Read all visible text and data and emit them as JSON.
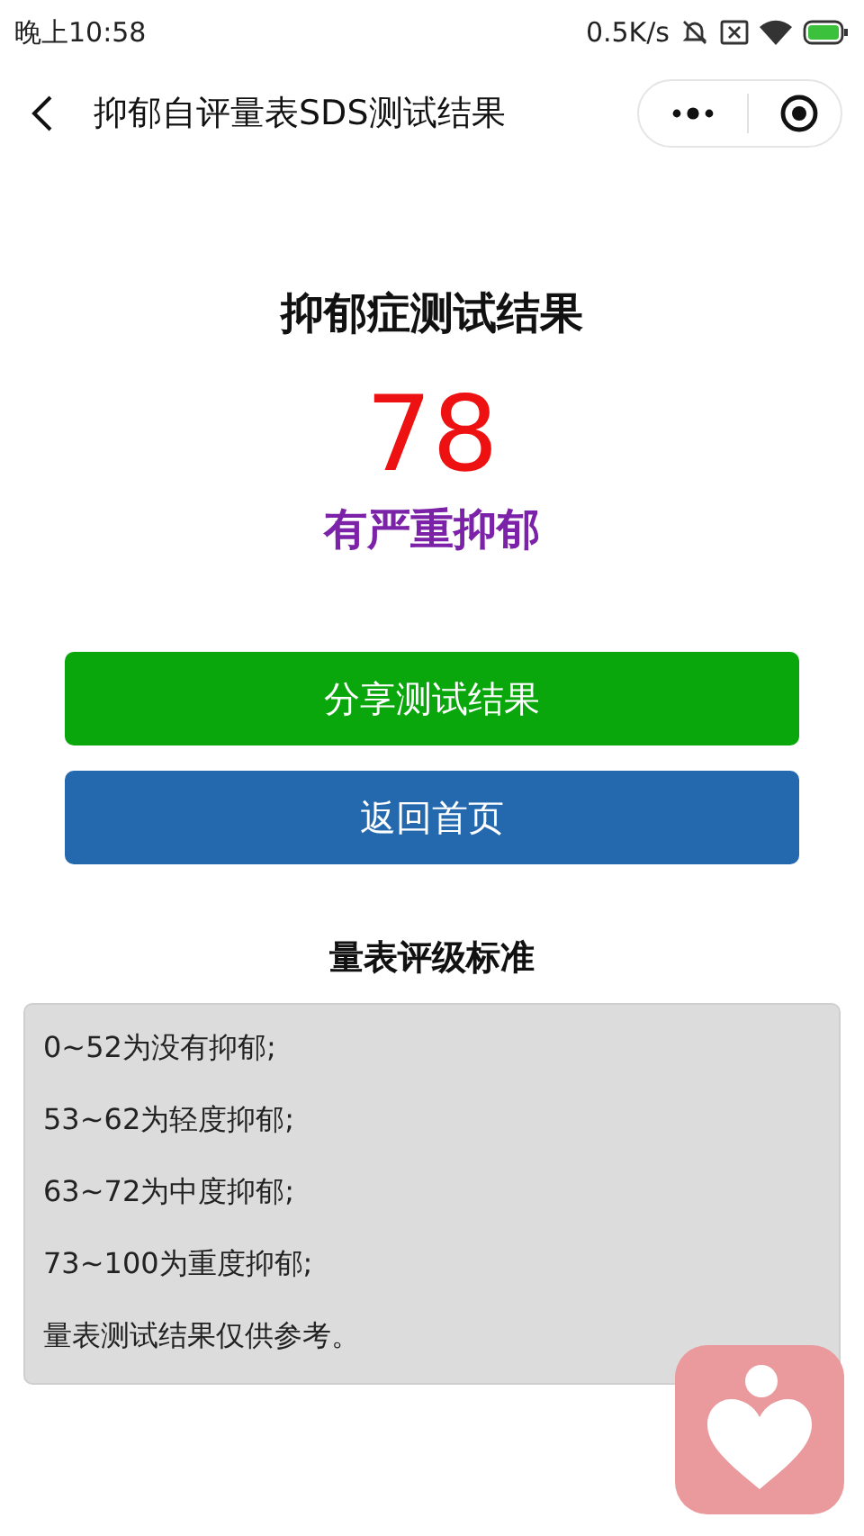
{
  "status_bar": {
    "time": "晚上10:58",
    "speed": "0.5K/s"
  },
  "nav": {
    "title": "抑郁自评量表SDS测试结果"
  },
  "result": {
    "title": "抑郁症测试结果",
    "score": "78",
    "level_text": "有严重抑郁"
  },
  "buttons": [
    {
      "label": "分享测试结果",
      "kind": "share"
    },
    {
      "label": "返回首页",
      "kind": "home"
    }
  ],
  "standard": {
    "title": "量表评级标准",
    "lines": [
      "0~52为没有抑郁;",
      "53~62为轻度抑郁;",
      "63~72为中度抑郁;",
      "73~100为重度抑郁;",
      "量表测试结果仅供参考。"
    ]
  }
}
